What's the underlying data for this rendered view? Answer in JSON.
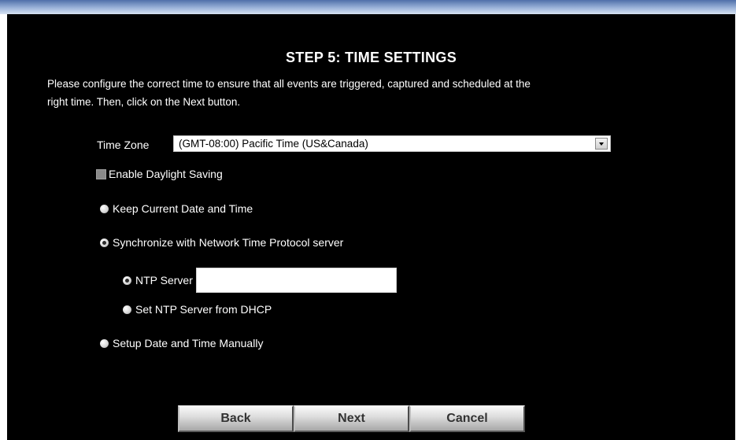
{
  "wizard": {
    "title": "STEP 5: TIME SETTINGS",
    "intro_line_1": "Please configure the correct time to ensure that all events are triggered, captured and scheduled at the",
    "intro_line_2": "right time. Then, click on the Next button."
  },
  "time_zone": {
    "label": "Time Zone",
    "selected": "(GMT-08:00) Pacific Time (US&Canada)"
  },
  "daylight_saving": {
    "label": "Enable Daylight Saving",
    "checked": false
  },
  "options": {
    "keep_current": {
      "label": "Keep Current Date and Time",
      "selected": false
    },
    "sync_ntp": {
      "label": "Synchronize with Network Time Protocol server",
      "selected": true
    },
    "ntp_server": {
      "label": "NTP Server",
      "value": "",
      "selected": true
    },
    "ntp_from_dhcp": {
      "label": "Set NTP Server from DHCP",
      "selected": false
    },
    "manual": {
      "label": "Setup Date and Time Manually",
      "selected": false
    }
  },
  "buttons": {
    "back": "Back",
    "next": "Next",
    "cancel": "Cancel"
  }
}
